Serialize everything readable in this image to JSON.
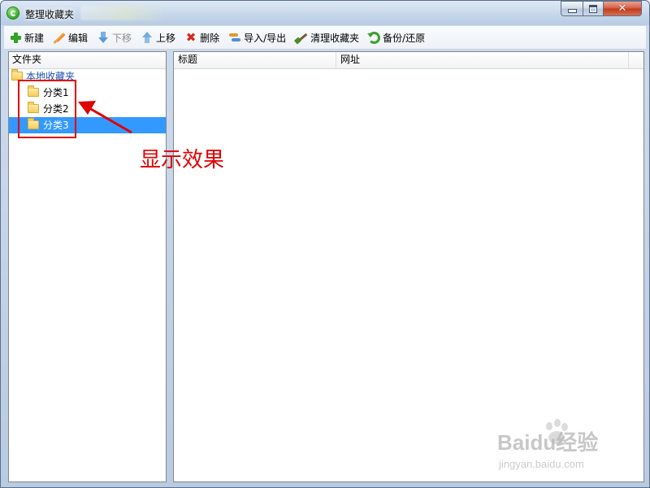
{
  "window": {
    "title": "整理收藏夹"
  },
  "toolbar": {
    "buttons": [
      {
        "label": "新建",
        "icon": "plus-icon",
        "enabled": true
      },
      {
        "label": "编辑",
        "icon": "pencil-icon",
        "enabled": true
      },
      {
        "label": "下移",
        "icon": "arrow-down-icon",
        "enabled": false
      },
      {
        "label": "上移",
        "icon": "arrow-up-icon",
        "enabled": true
      },
      {
        "label": "删除",
        "icon": "delete-x-icon",
        "enabled": true
      },
      {
        "label": "导入/导出",
        "icon": "import-export-icon",
        "enabled": true
      },
      {
        "label": "清理收藏夹",
        "icon": "broom-icon",
        "enabled": true
      },
      {
        "label": "备份/还原",
        "icon": "restore-icon",
        "enabled": true
      }
    ]
  },
  "folder_pane": {
    "header": "文件夹",
    "root": "本地收藏夹",
    "items": [
      "分类1",
      "分类2",
      "分类3"
    ],
    "selected_index": 2
  },
  "list_pane": {
    "columns": [
      "标题",
      "网址"
    ]
  },
  "annotation": {
    "text": "显示效果",
    "color": "#e00000"
  },
  "watermark": {
    "brand": "Baidu经验",
    "url": "jingyan.baidu.com"
  },
  "colors": {
    "selection": "#3399ff",
    "close_button": "#c2381a"
  }
}
